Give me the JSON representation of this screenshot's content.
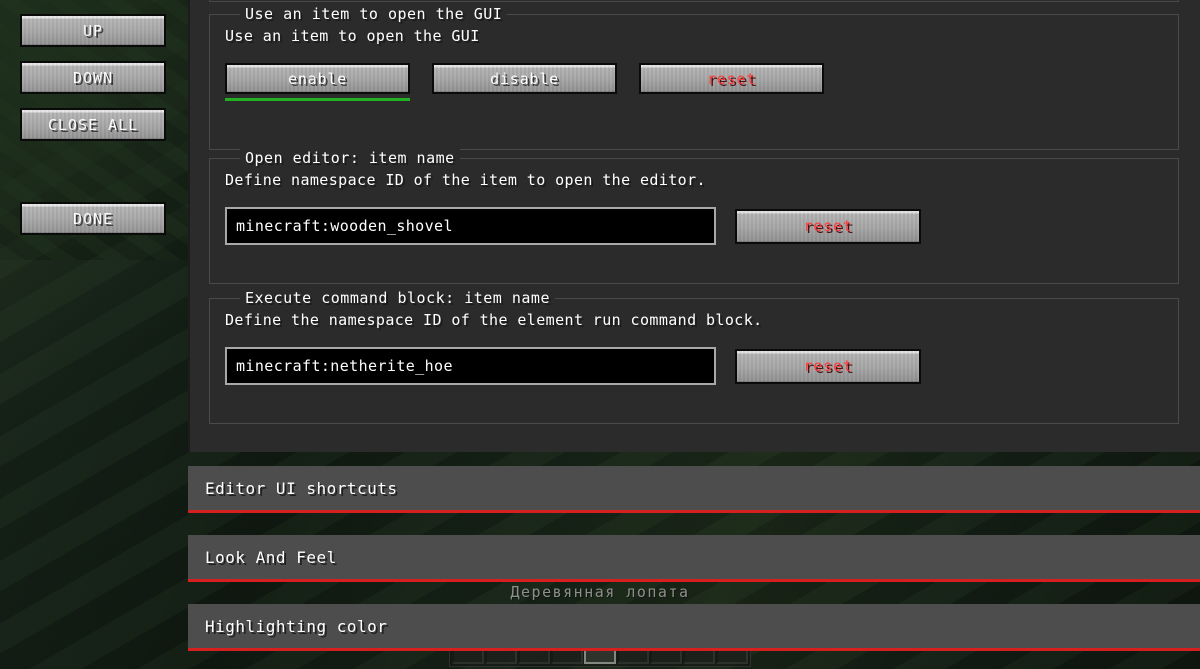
{
  "window": {
    "background_scene": "minecraft-world-dark-forest"
  },
  "sidebar": {
    "buttons": [
      {
        "label": "UP",
        "name": "up-button"
      },
      {
        "label": "DOWN",
        "name": "down-button"
      },
      {
        "label": "CLOSE ALL",
        "name": "close-all-button"
      },
      {
        "label": "DONE",
        "name": "done-button"
      }
    ]
  },
  "config": {
    "groups": [
      {
        "legend": "Use an item to open the GUI",
        "description": "Use an item to open the GUI",
        "control_type": "toggle",
        "buttons": [
          {
            "label": "enable",
            "selected": true
          },
          {
            "label": "disable",
            "selected": false
          },
          {
            "label": "reset",
            "selected": false
          }
        ],
        "selected_value": "enable"
      },
      {
        "legend": "Open editor: item name",
        "description": "Define namespace ID of the item to open the editor.",
        "control_type": "text-field",
        "value": "minecraft:wooden_shovel",
        "placeholder": "",
        "reset_label": "reset"
      },
      {
        "legend": "Execute command block: item name",
        "description": "Define the namespace ID of the element run command block.",
        "control_type": "text-field",
        "value": "minecraft:netherite_hoe",
        "placeholder": "",
        "reset_label": "reset"
      }
    ]
  },
  "sections": [
    {
      "title": "Editor UI shortcuts",
      "expanded": false
    },
    {
      "title": "Look And Feel",
      "expanded": false
    },
    {
      "title": "Highlighting color",
      "expanded": false
    }
  ],
  "hud": {
    "item_tooltip": "Деревянная лопата",
    "hotbar_slots": 9,
    "hotbar_selected_index": 4
  },
  "colors": {
    "accent_red": "#d61f1f",
    "selected_green": "#22b022",
    "reset_text": "#ff3a3a",
    "panel_bg": "#2b2b2b",
    "section_bg": "#4d4d4d"
  }
}
